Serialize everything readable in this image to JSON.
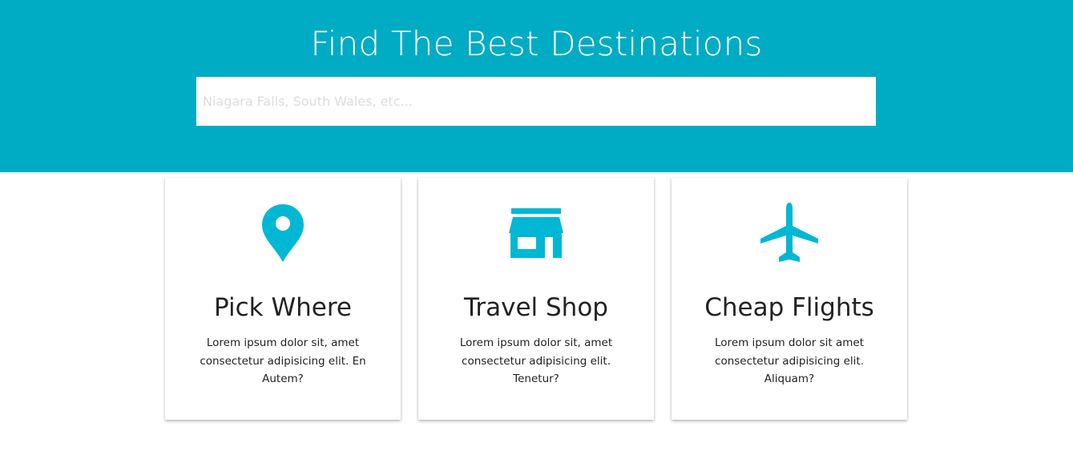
{
  "hero": {
    "title": "Find The Best Destinations",
    "background_color": "#00acc4"
  },
  "search": {
    "value": "",
    "placeholder": "Niagara Falls, South Wales, etc..."
  },
  "accent_color": "#00b7d4",
  "cards": [
    {
      "icon": "map-pin-icon",
      "title": "Pick Where",
      "text": "Lorem ipsum dolor sit, amet consectetur adipisicing elit. En Autem?"
    },
    {
      "icon": "store-icon",
      "title": "Travel Shop",
      "text": "Lorem ipsum dolor sit, amet consectetur adipisicing elit. Tenetur?"
    },
    {
      "icon": "plane-icon",
      "title": "Cheap Flights",
      "text": "Lorem ipsum dolor sit amet consectetur adipisicing elit. Aliquam?"
    }
  ]
}
